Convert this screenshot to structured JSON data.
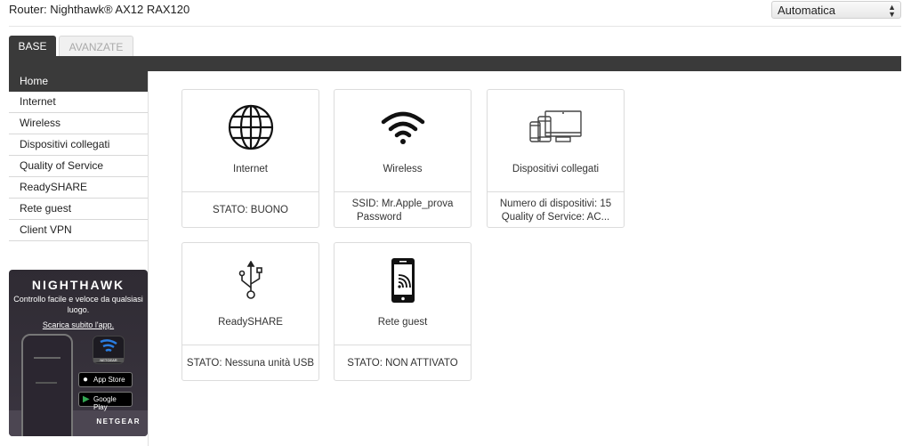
{
  "header": {
    "router_label": "Router: Nighthawk® AX12 RAX120",
    "language_select": {
      "selected": "Automatica"
    }
  },
  "tabs": [
    {
      "label": "BASE",
      "active": true
    },
    {
      "label": "AVANZATE",
      "active": false
    }
  ],
  "sidebar": {
    "items": [
      {
        "label": "Home",
        "active": true
      },
      {
        "label": "Internet"
      },
      {
        "label": "Wireless"
      },
      {
        "label": "Dispositivi collegati"
      },
      {
        "label": "Quality of Service"
      },
      {
        "label": "ReadySHARE"
      },
      {
        "label": "Rete guest"
      },
      {
        "label": "Client VPN"
      }
    ]
  },
  "promo": {
    "brand": "NIGHTHAWK",
    "text": "Controllo facile e veloce da qualsiasi luogo.",
    "link": "Scarica subito l'app.",
    "app_icon_label": "NETGEAR",
    "app_store": "App Store",
    "google_play": "Google Play",
    "company": "NETGEAR"
  },
  "cards": [
    {
      "id": "internet",
      "title": "Internet",
      "icon": "globe-icon",
      "status": [
        "STATO: BUONO"
      ]
    },
    {
      "id": "wireless",
      "title": "Wireless",
      "icon": "wifi-icon",
      "status": [
        "SSID: Mr.Apple_prova",
        "Password"
      ]
    },
    {
      "id": "devices",
      "title": "Dispositivi collegati",
      "icon": "devices-icon",
      "status": [
        "Numero di dispositivi: 15",
        "Quality of Service: AC..."
      ]
    },
    {
      "id": "readyshare",
      "title": "ReadySHARE",
      "icon": "usb-icon",
      "status": [
        "STATO: Nessuna unità USB"
      ]
    },
    {
      "id": "guest",
      "title": "Rete guest",
      "icon": "phone-wifi-icon",
      "status": [
        "STATO: NON ATTIVATO"
      ]
    }
  ]
}
